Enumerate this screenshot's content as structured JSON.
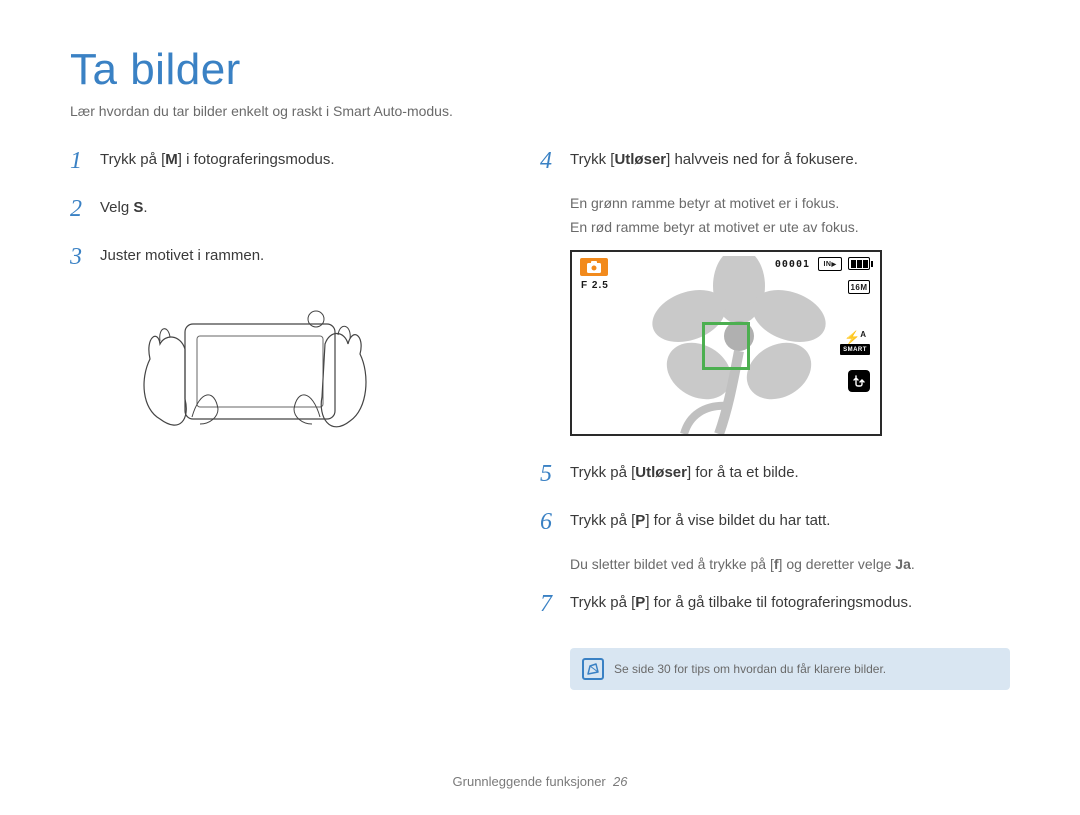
{
  "title": "Ta bilder",
  "subtitle": "Lær hvordan du tar bilder enkelt og raskt i Smart Auto-modus.",
  "left": {
    "step1": {
      "num": "1",
      "text_a": "Trykk på [",
      "text_b": "M",
      "text_c": "] i fotograferingsmodus."
    },
    "step2": {
      "num": "2",
      "text_a": "Velg ",
      "text_b": "S",
      "text_c": "."
    },
    "step3": {
      "num": "3",
      "text": "Juster motivet i rammen."
    }
  },
  "right": {
    "step4": {
      "num": "4",
      "text_a": "Trykk [",
      "text_b": "Utløser",
      "text_c": "] halvveis ned for å fokusere.",
      "sub1": "En grønn ramme betyr at motivet er i fokus.",
      "sub2": "En rød ramme betyr at motivet er ute av fokus."
    },
    "screen": {
      "f_label": "F 2.5",
      "counter": "00001",
      "card": "IN",
      "size": "16M",
      "flash_label": "SMART"
    },
    "step5": {
      "num": "5",
      "text_a": "Trykk på [",
      "text_b": "Utløser",
      "text_c": "] for å ta et bilde."
    },
    "step6": {
      "num": "6",
      "text_a": "Trykk på [",
      "text_b": "P",
      "text_c": "] for å vise bildet du har tatt.",
      "sub_a": "Du sletter bildet ved å trykke på [",
      "sub_b": "f",
      "sub_c": "] og deretter velge ",
      "sub_d": "Ja",
      "sub_e": "."
    },
    "step7": {
      "num": "7",
      "text_a": "Trykk på [",
      "text_b": "P",
      "text_c": "] for å gå tilbake til fotograferingsmodus."
    },
    "tip": "Se side 30 for tips om hvordan du får klarere bilder."
  },
  "footer": {
    "section": "Grunnleggende funksjoner",
    "page": "26"
  }
}
